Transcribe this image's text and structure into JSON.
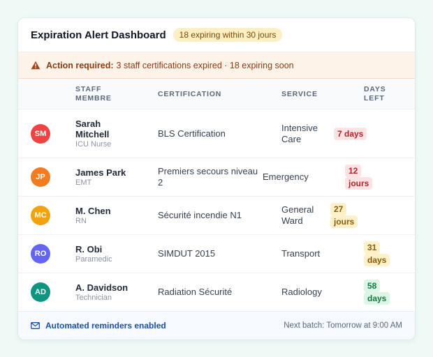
{
  "header": {
    "title": "Expiration Alert Dashboard",
    "badge": "18 expiring within 30 jours"
  },
  "alert": {
    "label": "Action required:",
    "message": "3 staff certifications expired · 18 expiring soon",
    "icon": "warning-triangle-icon"
  },
  "columns": {
    "staff": "STAFF MEMBRE",
    "certification": "CERTIFICATION",
    "service": "SERVICE",
    "days": "DAYS LEFT"
  },
  "rows": [
    {
      "initials": "SM",
      "avatar_color": "#ef4444",
      "name": "Sarah Mitchell",
      "role": "ICU Nurse",
      "certification": "BLS Certification",
      "service": "Intensive Care",
      "days": "7 days",
      "status": "red"
    },
    {
      "initials": "JP",
      "avatar_color": "#f47c20",
      "name": "James Park",
      "role": "EMT",
      "certification": "Premiers secours niveau 2",
      "service": "Emergency",
      "days": "12 jours",
      "status": "red"
    },
    {
      "initials": "MC",
      "avatar_color": "#f2a20c",
      "name": "M. Chen",
      "role": "RN",
      "certification": "Sécurité incendie N1",
      "service": "General Ward",
      "days": "27 jours",
      "status": "amber"
    },
    {
      "initials": "RO",
      "avatar_color": "#6366f1",
      "name": "R. Obi",
      "role": "Paramedic",
      "certification": "SIMDUT 2015",
      "service": "Transport",
      "days": "31 days",
      "status": "amber"
    },
    {
      "initials": "AD",
      "avatar_color": "#0f9482",
      "name": "A. Davidson",
      "role": "Technician",
      "certification": "Radiation Sécurité",
      "service": "Radiology",
      "days": "58 days",
      "status": "green"
    }
  ],
  "footer": {
    "reminders": "Automated reminders enabled",
    "next_batch": "Next batch: Tomorrow at 9:00 AM",
    "icon": "mail-icon"
  },
  "colors": {
    "status_red": "#b4232c",
    "status_amber": "#8a5a08",
    "status_green": "#157a3f",
    "accent_blue": "#1d4fa8"
  }
}
